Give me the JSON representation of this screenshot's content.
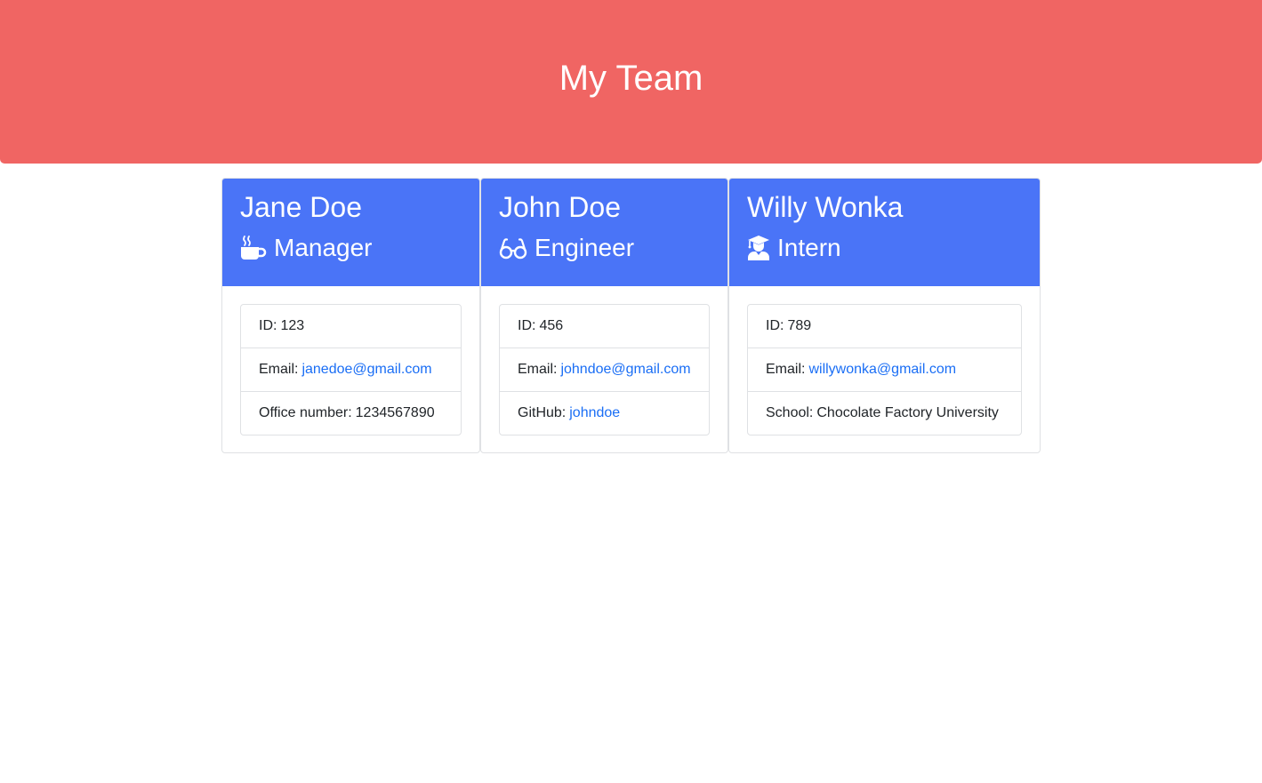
{
  "header": {
    "title": "My Team"
  },
  "colors": {
    "header_bg": "#f06563",
    "card_header_bg": "#4a74f7",
    "link": "#1a6ef5"
  },
  "employees": [
    {
      "name": "Jane Doe",
      "role": "Manager",
      "role_icon": "mug-hot-icon",
      "id_label": "ID:",
      "id": "123",
      "email_label": "Email:",
      "email": "janedoe@gmail.com",
      "extra_label": "Office number:",
      "extra_value": "1234567890"
    },
    {
      "name": "John Doe",
      "role": "Engineer",
      "role_icon": "glasses-icon",
      "id_label": "ID:",
      "id": "456",
      "email_label": "Email:",
      "email": "johndoe@gmail.com",
      "extra_label": "GitHub:",
      "extra_value": "johndoe"
    },
    {
      "name": "Willy Wonka",
      "role": "Intern",
      "role_icon": "user-graduate-icon",
      "id_label": "ID:",
      "id": "789",
      "email_label": "Email:",
      "email": "willywonka@gmail.com",
      "extra_label": "School:",
      "extra_value": "Chocolate Factory University"
    }
  ]
}
